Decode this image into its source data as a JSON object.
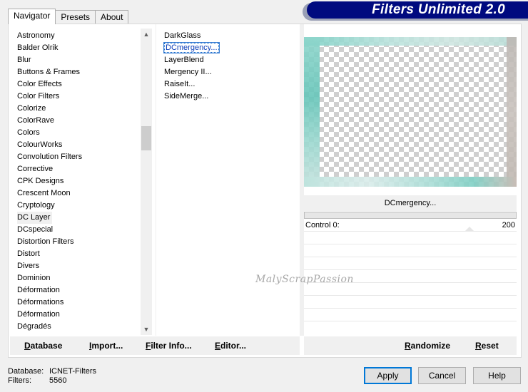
{
  "tabs": [
    "Navigator",
    "Presets",
    "About"
  ],
  "app_title": "Filters Unlimited 2.0",
  "categories": [
    "Astronomy",
    "Balder Olrik",
    "Blur",
    "Buttons & Frames",
    "Color Effects",
    "Color Filters",
    "Colorize",
    "ColorRave",
    "Colors",
    "ColourWorks",
    "Convolution Filters",
    "Corrective",
    "CPK Designs",
    "Crescent Moon",
    "Cryptology",
    "DC Layer",
    "DCspecial",
    "Distortion Filters",
    "Distort",
    "Divers",
    "Dominion",
    "Déformation",
    "Déformations",
    "Déformation",
    "Dégradés"
  ],
  "selected_category": "DC Layer",
  "filters": [
    "DarkGlass",
    "DCmergency...",
    "LayerBlend",
    "Mergency II...",
    "RaiseIt...",
    "SideMerge..."
  ],
  "selected_filter": "DCmergency...",
  "preview_filter_name": "DCmergency...",
  "control": {
    "label": "Control 0:",
    "value": "200"
  },
  "watermark": "MalyScrapPassion",
  "left_buttons": [
    "Database",
    "Import...",
    "Filter Info...",
    "Editor..."
  ],
  "right_buttons": [
    "Randomize",
    "Reset"
  ],
  "status": {
    "database_label": "Database:",
    "database_value": "ICNET-Filters",
    "filters_label": "Filters:",
    "filters_value": "5560"
  },
  "dialog_buttons": {
    "apply": "Apply",
    "cancel": "Cancel",
    "help": "Help"
  },
  "colors": {
    "banner": "#000a7f",
    "selection": "#0a3cb8",
    "preview_edge": "#6cc7bd"
  }
}
